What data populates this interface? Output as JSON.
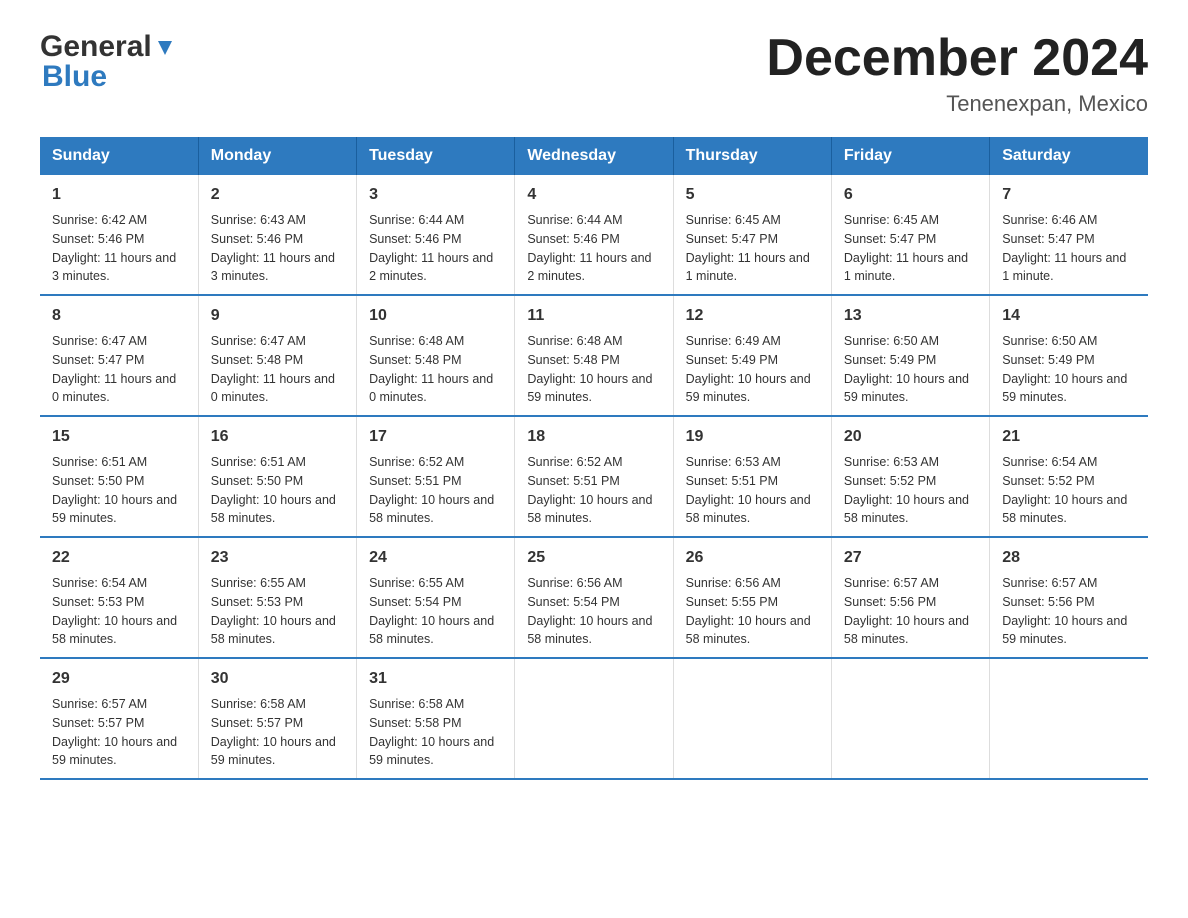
{
  "header": {
    "logo_general": "General",
    "logo_blue": "Blue",
    "title": "December 2024",
    "subtitle": "Tenenexpan, Mexico"
  },
  "calendar": {
    "days_of_week": [
      "Sunday",
      "Monday",
      "Tuesday",
      "Wednesday",
      "Thursday",
      "Friday",
      "Saturday"
    ],
    "weeks": [
      [
        {
          "day": "1",
          "sunrise": "6:42 AM",
          "sunset": "5:46 PM",
          "daylight": "11 hours and 3 minutes."
        },
        {
          "day": "2",
          "sunrise": "6:43 AM",
          "sunset": "5:46 PM",
          "daylight": "11 hours and 3 minutes."
        },
        {
          "day": "3",
          "sunrise": "6:44 AM",
          "sunset": "5:46 PM",
          "daylight": "11 hours and 2 minutes."
        },
        {
          "day": "4",
          "sunrise": "6:44 AM",
          "sunset": "5:46 PM",
          "daylight": "11 hours and 2 minutes."
        },
        {
          "day": "5",
          "sunrise": "6:45 AM",
          "sunset": "5:47 PM",
          "daylight": "11 hours and 1 minute."
        },
        {
          "day": "6",
          "sunrise": "6:45 AM",
          "sunset": "5:47 PM",
          "daylight": "11 hours and 1 minute."
        },
        {
          "day": "7",
          "sunrise": "6:46 AM",
          "sunset": "5:47 PM",
          "daylight": "11 hours and 1 minute."
        }
      ],
      [
        {
          "day": "8",
          "sunrise": "6:47 AM",
          "sunset": "5:47 PM",
          "daylight": "11 hours and 0 minutes."
        },
        {
          "day": "9",
          "sunrise": "6:47 AM",
          "sunset": "5:48 PM",
          "daylight": "11 hours and 0 minutes."
        },
        {
          "day": "10",
          "sunrise": "6:48 AM",
          "sunset": "5:48 PM",
          "daylight": "11 hours and 0 minutes."
        },
        {
          "day": "11",
          "sunrise": "6:48 AM",
          "sunset": "5:48 PM",
          "daylight": "10 hours and 59 minutes."
        },
        {
          "day": "12",
          "sunrise": "6:49 AM",
          "sunset": "5:49 PM",
          "daylight": "10 hours and 59 minutes."
        },
        {
          "day": "13",
          "sunrise": "6:50 AM",
          "sunset": "5:49 PM",
          "daylight": "10 hours and 59 minutes."
        },
        {
          "day": "14",
          "sunrise": "6:50 AM",
          "sunset": "5:49 PM",
          "daylight": "10 hours and 59 minutes."
        }
      ],
      [
        {
          "day": "15",
          "sunrise": "6:51 AM",
          "sunset": "5:50 PM",
          "daylight": "10 hours and 59 minutes."
        },
        {
          "day": "16",
          "sunrise": "6:51 AM",
          "sunset": "5:50 PM",
          "daylight": "10 hours and 58 minutes."
        },
        {
          "day": "17",
          "sunrise": "6:52 AM",
          "sunset": "5:51 PM",
          "daylight": "10 hours and 58 minutes."
        },
        {
          "day": "18",
          "sunrise": "6:52 AM",
          "sunset": "5:51 PM",
          "daylight": "10 hours and 58 minutes."
        },
        {
          "day": "19",
          "sunrise": "6:53 AM",
          "sunset": "5:51 PM",
          "daylight": "10 hours and 58 minutes."
        },
        {
          "day": "20",
          "sunrise": "6:53 AM",
          "sunset": "5:52 PM",
          "daylight": "10 hours and 58 minutes."
        },
        {
          "day": "21",
          "sunrise": "6:54 AM",
          "sunset": "5:52 PM",
          "daylight": "10 hours and 58 minutes."
        }
      ],
      [
        {
          "day": "22",
          "sunrise": "6:54 AM",
          "sunset": "5:53 PM",
          "daylight": "10 hours and 58 minutes."
        },
        {
          "day": "23",
          "sunrise": "6:55 AM",
          "sunset": "5:53 PM",
          "daylight": "10 hours and 58 minutes."
        },
        {
          "day": "24",
          "sunrise": "6:55 AM",
          "sunset": "5:54 PM",
          "daylight": "10 hours and 58 minutes."
        },
        {
          "day": "25",
          "sunrise": "6:56 AM",
          "sunset": "5:54 PM",
          "daylight": "10 hours and 58 minutes."
        },
        {
          "day": "26",
          "sunrise": "6:56 AM",
          "sunset": "5:55 PM",
          "daylight": "10 hours and 58 minutes."
        },
        {
          "day": "27",
          "sunrise": "6:57 AM",
          "sunset": "5:56 PM",
          "daylight": "10 hours and 58 minutes."
        },
        {
          "day": "28",
          "sunrise": "6:57 AM",
          "sunset": "5:56 PM",
          "daylight": "10 hours and 59 minutes."
        }
      ],
      [
        {
          "day": "29",
          "sunrise": "6:57 AM",
          "sunset": "5:57 PM",
          "daylight": "10 hours and 59 minutes."
        },
        {
          "day": "30",
          "sunrise": "6:58 AM",
          "sunset": "5:57 PM",
          "daylight": "10 hours and 59 minutes."
        },
        {
          "day": "31",
          "sunrise": "6:58 AM",
          "sunset": "5:58 PM",
          "daylight": "10 hours and 59 minutes."
        },
        {
          "day": "",
          "sunrise": "",
          "sunset": "",
          "daylight": ""
        },
        {
          "day": "",
          "sunrise": "",
          "sunset": "",
          "daylight": ""
        },
        {
          "day": "",
          "sunrise": "",
          "sunset": "",
          "daylight": ""
        },
        {
          "day": "",
          "sunrise": "",
          "sunset": "",
          "daylight": ""
        }
      ]
    ]
  }
}
